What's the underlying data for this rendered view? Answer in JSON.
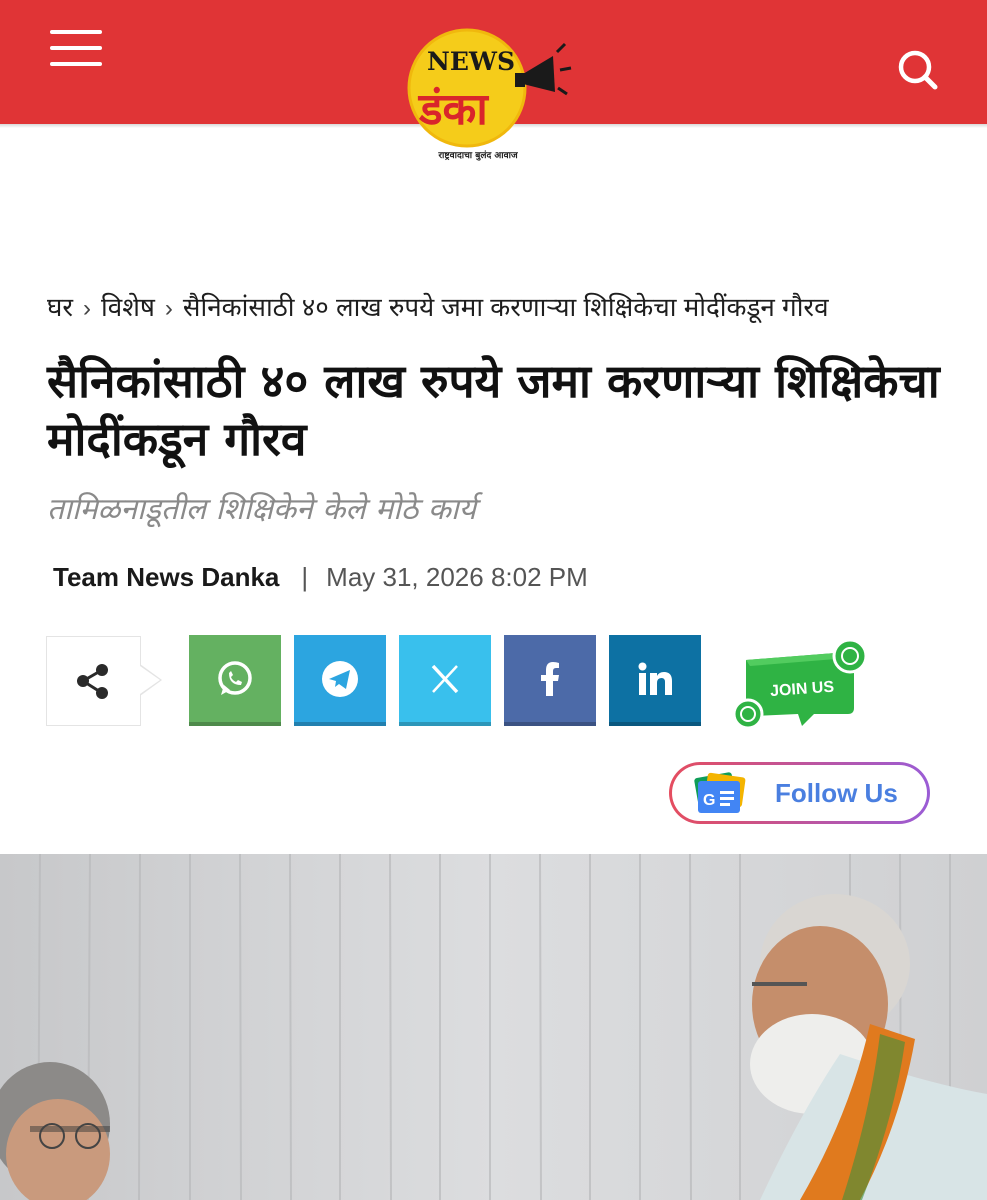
{
  "header": {
    "menu_icon": "hamburger-icon",
    "search_icon": "search-icon",
    "logo": {
      "top_text": "NEWS",
      "main_text": "डंका",
      "tagline": "राष्ट्रवादाचा बुलंद आवाज"
    },
    "colors": {
      "header_bg": "#e03436",
      "logo_yellow": "#f5cc1a",
      "logo_red": "#d9252b"
    }
  },
  "breadcrumb": {
    "items": [
      "घर",
      "विशेष",
      "सैनिकांसाठी ४० लाख रुपये जमा करणाऱ्या शिक्षिकेचा मोदींकडून गौरव"
    ],
    "separator": "›"
  },
  "article": {
    "title": "सैनिकांसाठी ४० लाख रुपये जमा करणाऱ्या शिक्षिकेचा मोदींकडून गौरव",
    "subtitle": "तामिळनाडूतील शिक्षिकेने केले मोठे कार्य",
    "author": "Team News Danka",
    "separator": "|",
    "date": "May 31, 2026 8:02 PM"
  },
  "share": {
    "share_icon": "share-icon",
    "buttons": [
      {
        "name": "whatsapp",
        "icon": "whatsapp-icon",
        "color": "#64b161"
      },
      {
        "name": "telegram",
        "icon": "telegram-icon",
        "color": "#2ca5e0"
      },
      {
        "name": "x",
        "icon": "x-icon",
        "color": "#39c0ed"
      },
      {
        "name": "facebook",
        "icon": "facebook-icon",
        "color": "#4c6aa8"
      },
      {
        "name": "linkedin",
        "icon": "linkedin-icon",
        "color": "#0d71a3"
      }
    ],
    "join": {
      "label": "JOIN US",
      "color": "#2fb344"
    }
  },
  "follow": {
    "label": "Follow Us",
    "icon": "google-news-icon"
  },
  "photo": {
    "description_icon": "article-photo"
  }
}
